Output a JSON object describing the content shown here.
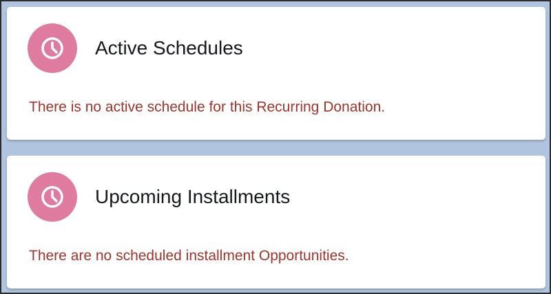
{
  "cards": [
    {
      "title": "Active Schedules",
      "message": "There is no active schedule for this Recurring Donation.",
      "icon": "clock-icon"
    },
    {
      "title": "Upcoming Installments",
      "message": "There are no scheduled installment Opportunities.",
      "icon": "clock-icon"
    }
  ],
  "colors": {
    "page_background": "#b0c4df",
    "card_background": "#ffffff",
    "icon_background": "#e07ba0",
    "title_text": "#16181d",
    "message_text": "#a3332a"
  }
}
